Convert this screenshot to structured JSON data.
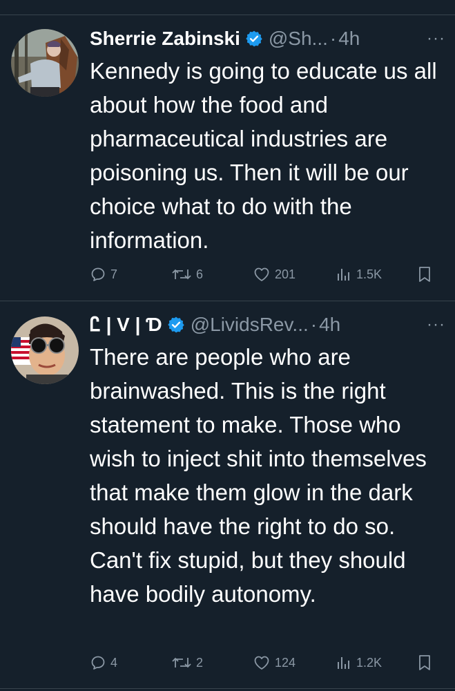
{
  "colors": {
    "background": "#15202b",
    "text": "#ffffff",
    "secondary_text": "#8b98a5",
    "divider": "#38444d",
    "verified_badge": "#1d9bf0"
  },
  "tweets": [
    {
      "author_name": "Sherrie Zabinski",
      "verified": true,
      "handle": "@Sh...",
      "separator": "·",
      "time": "4h",
      "more_icon": "more-dots-icon",
      "text": "Kennedy is going to educate us all about how the food and pharmaceutical industries are poisoning us. Then it will be our choice what to do with the information.",
      "replies": "7",
      "reposts": "6",
      "likes": "201",
      "views": "1.5K"
    },
    {
      "author_name": "Ꮭ | V | Ɗ",
      "verified": true,
      "handle": "@LividsRev...",
      "separator": "·",
      "time": "4h",
      "more_icon": "more-dots-icon",
      "text": "There are people who are brainwashed. This is the right statement to make. Those who wish to inject shit into themselves that make them glow in the dark should have the right to do so. Can't fix stupid, but they should have bodily autonomy.",
      "replies": "4",
      "reposts": "2",
      "likes": "124",
      "views": "1.2K"
    }
  ]
}
